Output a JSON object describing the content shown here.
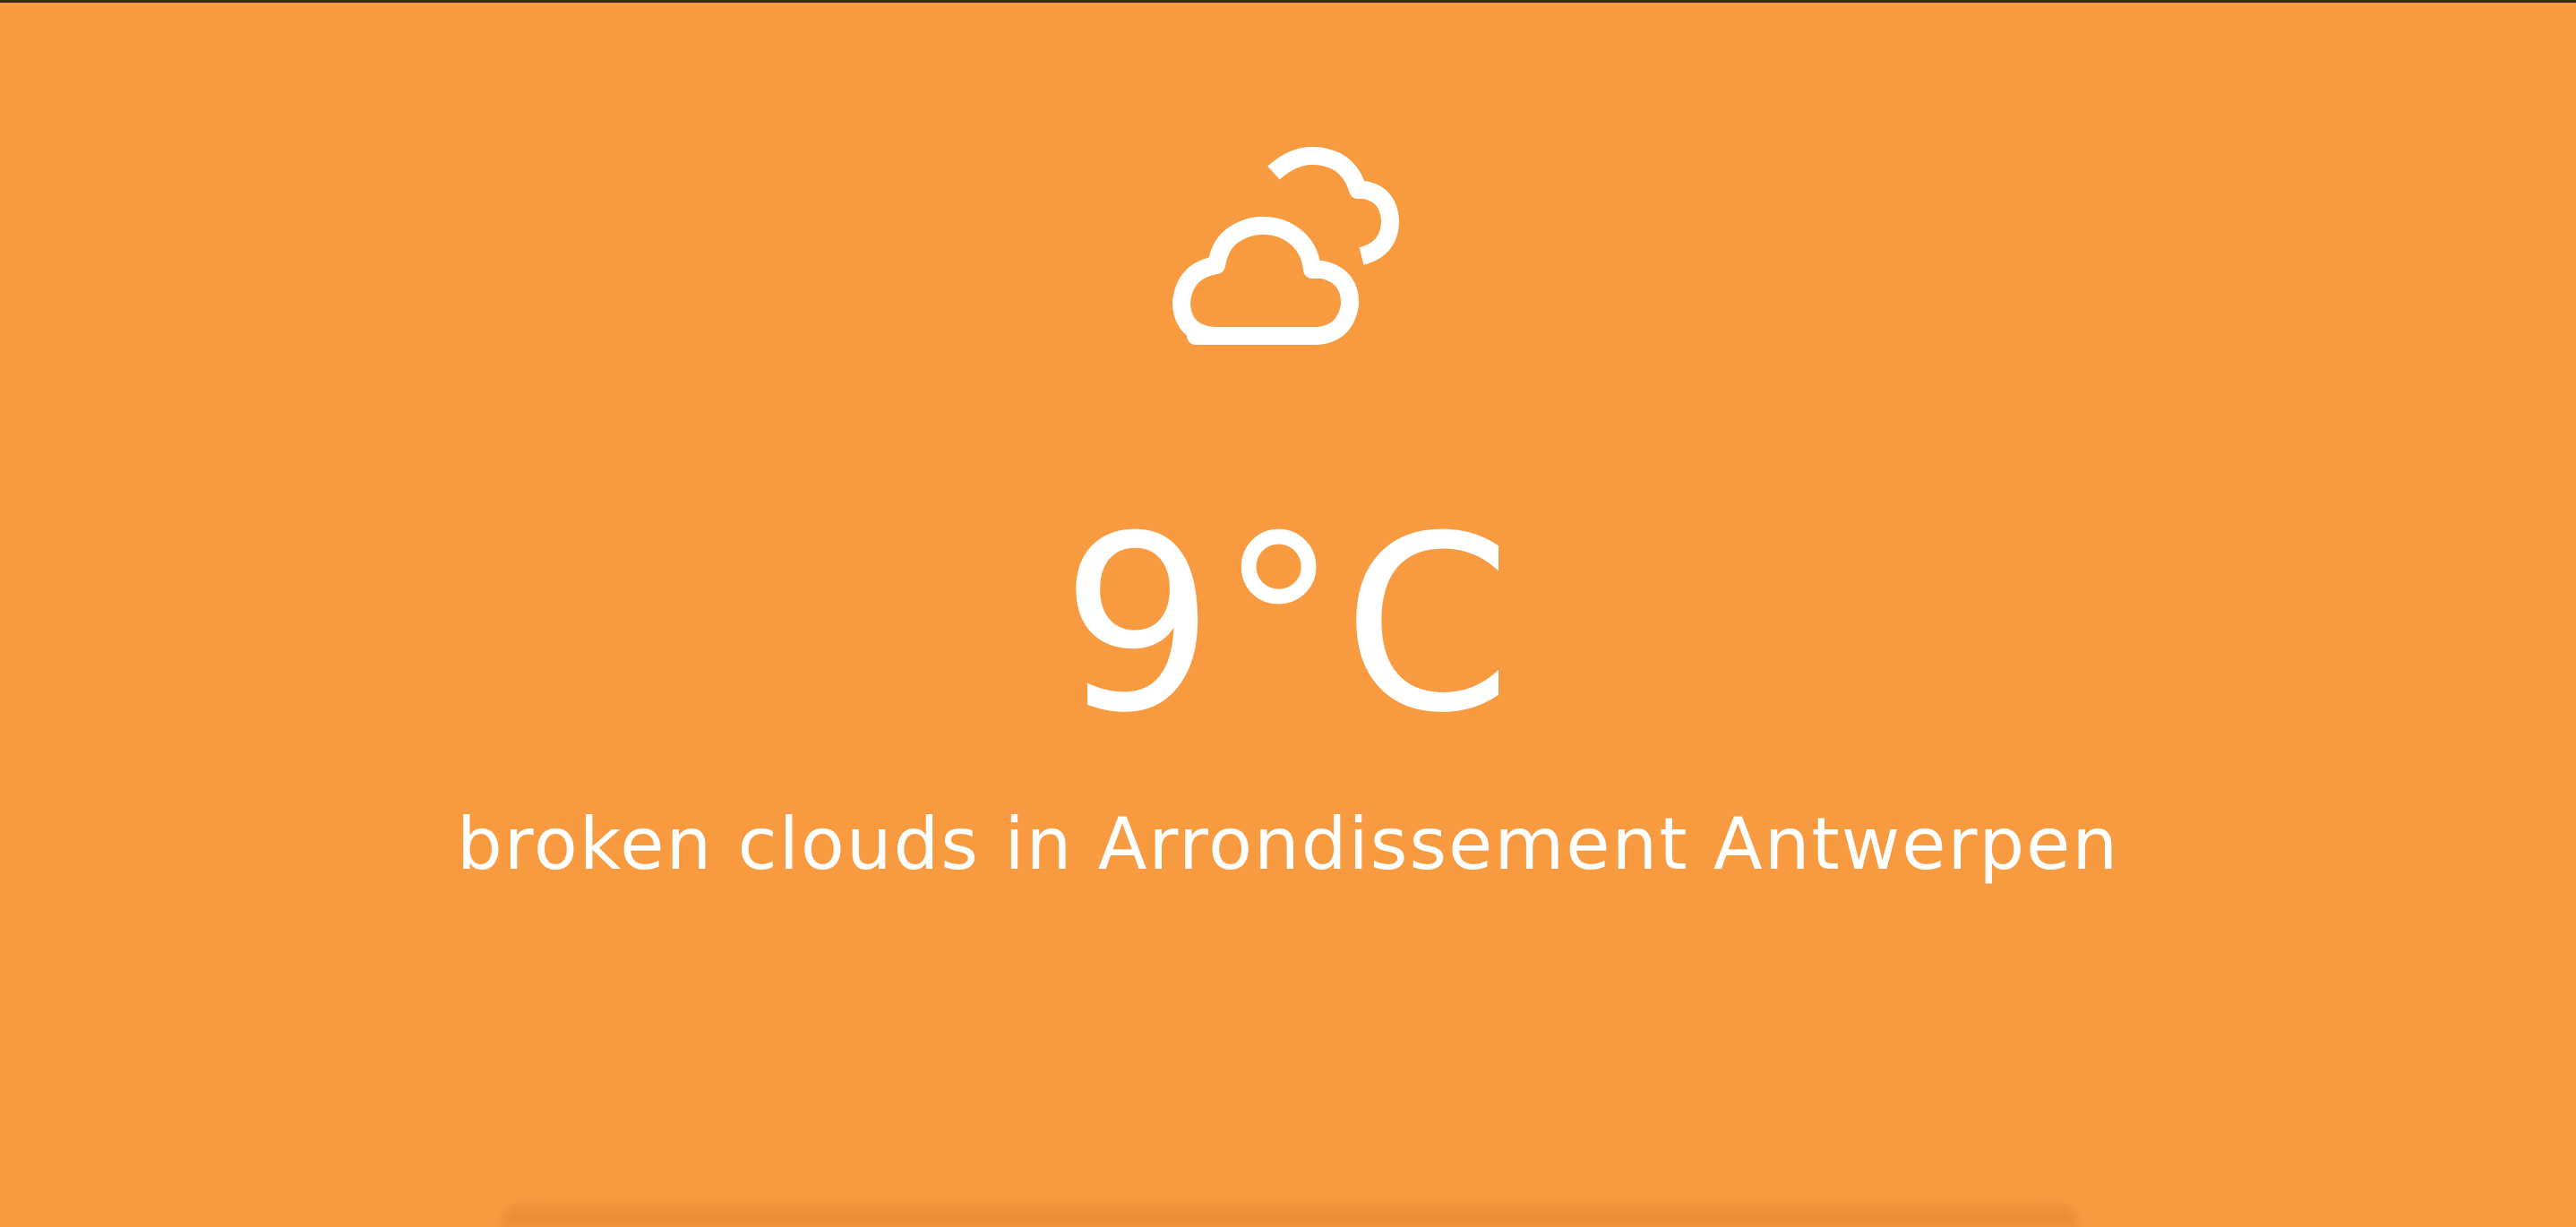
{
  "weather": {
    "icon": "cloudy-icon",
    "temperature": "9°C",
    "description": "broken clouds in Arrondissement Antwerpen"
  },
  "colors": {
    "background": "#f89b40",
    "foreground": "#ffffff"
  }
}
